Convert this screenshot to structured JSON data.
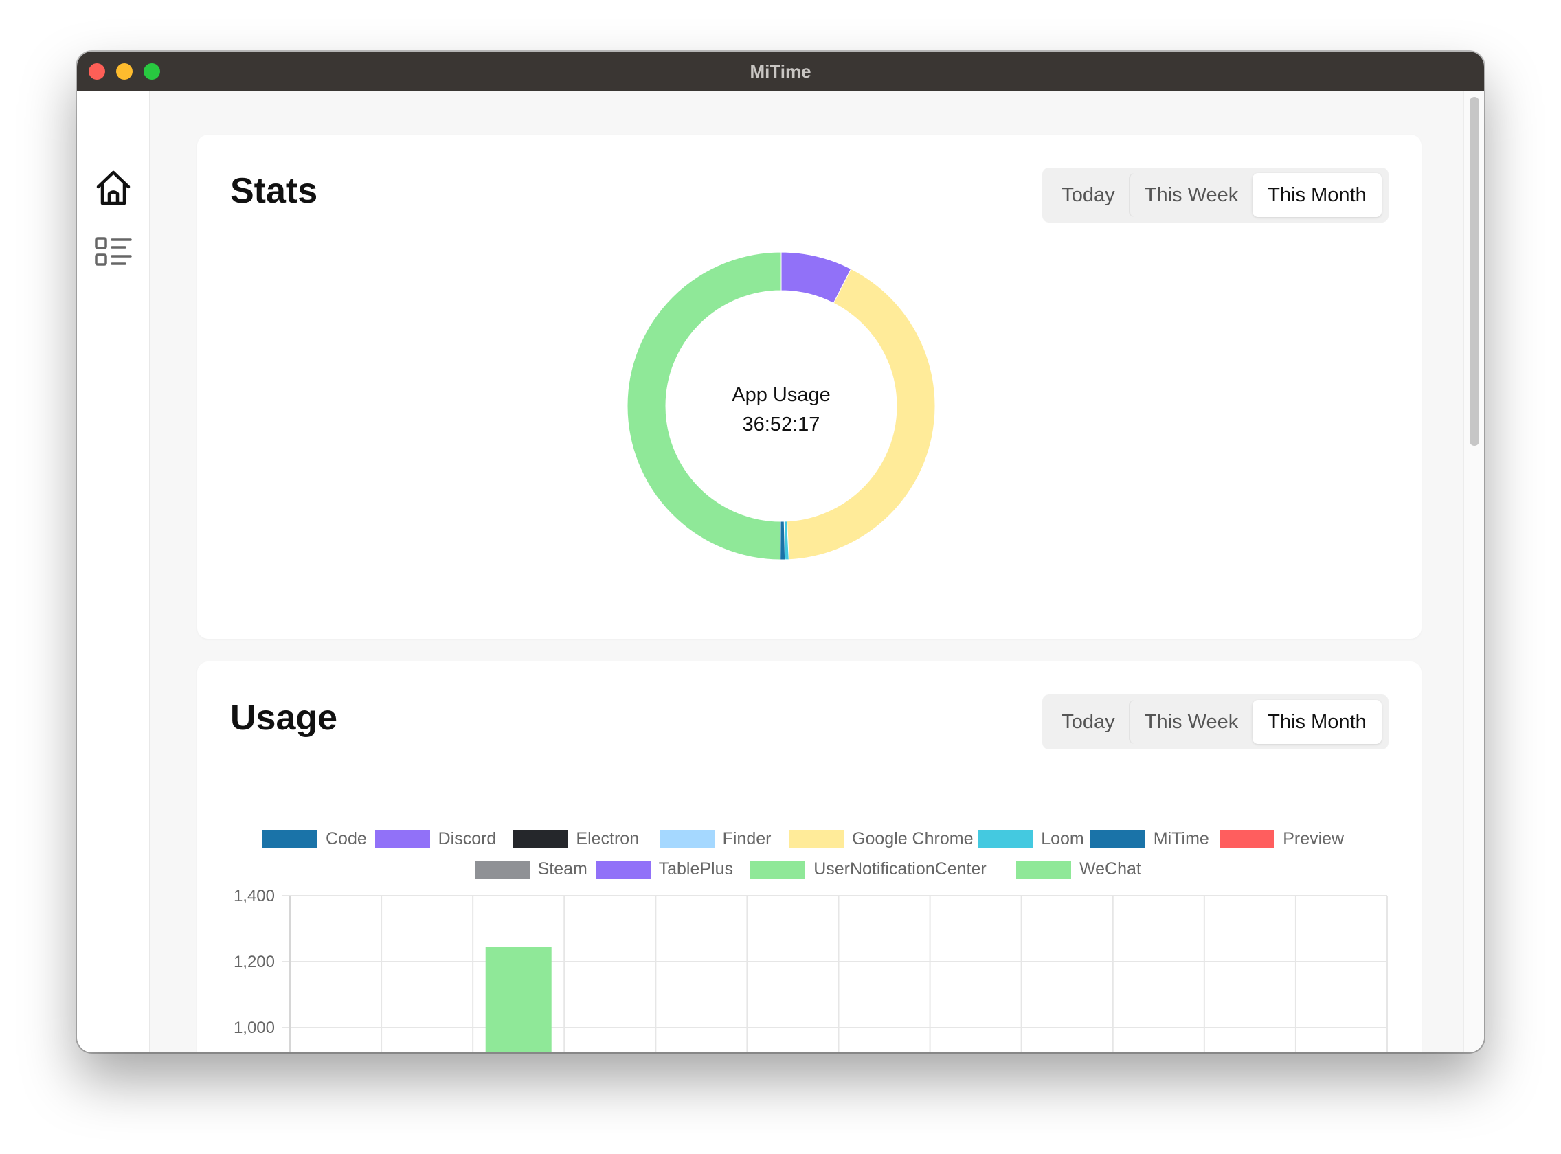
{
  "window": {
    "title": "MiTime"
  },
  "sidebar": {
    "items": [
      {
        "icon": "home-icon"
      },
      {
        "icon": "list-icon"
      }
    ]
  },
  "stats": {
    "title": "Stats",
    "tabs": [
      "Today",
      "This Week",
      "This Month"
    ],
    "selected_tab": "This Month",
    "center_label": "App Usage",
    "center_value": "36:52:17"
  },
  "usage": {
    "title": "Usage",
    "tabs": [
      "Today",
      "This Week",
      "This Month"
    ],
    "selected_tab": "This Month"
  },
  "chart_data": [
    {
      "type": "pie",
      "variant": "doughnut",
      "slices": [
        {
          "label": "Discord",
          "value": 7.5,
          "color": "#9171f8"
        },
        {
          "label": "Google Chrome",
          "value": 41.7,
          "color": "#ffeb99"
        },
        {
          "label": "Loom",
          "value": 0.4,
          "color": "#44c9e0"
        },
        {
          "label": "MiTime",
          "value": 0.5,
          "color": "#1a73a8"
        },
        {
          "label": "UserNotificationCenter",
          "value": 49.9,
          "color": "#8fe898"
        }
      ]
    },
    {
      "type": "bar",
      "legend": [
        {
          "label": "Code",
          "color": "#1a73a8"
        },
        {
          "label": "Discord",
          "color": "#9171f8"
        },
        {
          "label": "Electron",
          "color": "#25272b"
        },
        {
          "label": "Finder",
          "color": "#a5d8ff"
        },
        {
          "label": "Google Chrome",
          "color": "#ffeb99"
        },
        {
          "label": "Loom",
          "color": "#44c9e0"
        },
        {
          "label": "MiTime",
          "color": "#1a73a8"
        },
        {
          "label": "Preview",
          "color": "#ff5e5e"
        },
        {
          "label": "Steam",
          "color": "#8f9195"
        },
        {
          "label": "TablePlus",
          "color": "#9171f8"
        },
        {
          "label": "UserNotificationCenter",
          "color": "#8fe898"
        },
        {
          "label": "WeChat",
          "color": "#8fe898"
        }
      ],
      "yticks": [
        "1,400",
        "1,200",
        "1,000"
      ],
      "ylim": [
        1000,
        1400
      ],
      "bars": [
        {
          "column": 3,
          "series": "UserNotificationCenter",
          "value": 1245
        }
      ],
      "grid": true
    }
  ]
}
